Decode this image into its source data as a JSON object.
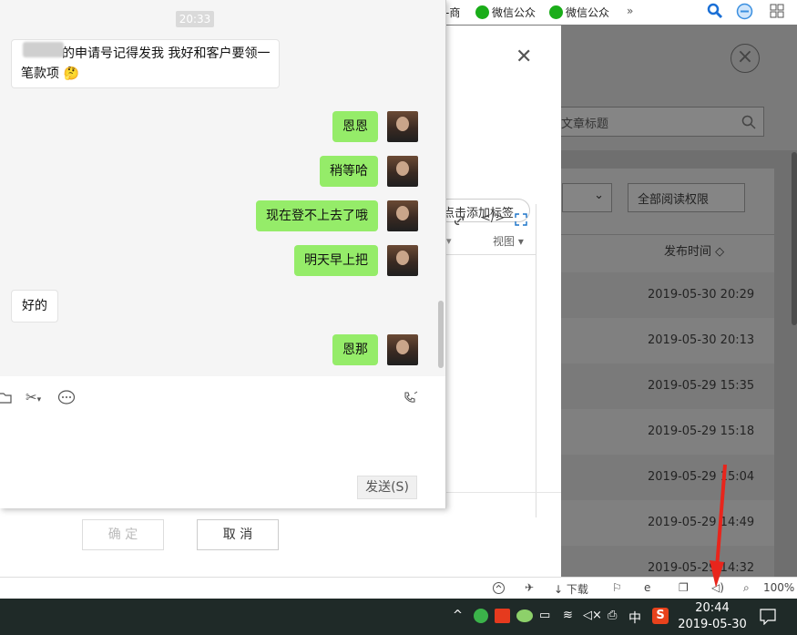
{
  "bookmarks": {
    "item1": "-商",
    "item2": "微信公众",
    "item3": "微信公众",
    "more": "»"
  },
  "background_page": {
    "search_placeholder": "文章标题",
    "filter_permission": "全部阅读权限",
    "column_publish_time": "发布时间 ◇",
    "dates": [
      "2019-05-30 20:29",
      "2019-05-30 20:13",
      "2019-05-29 15:35",
      "2019-05-29 15:18",
      "2019-05-29 15:04",
      "2019-05-29 14:49",
      "2019-05-29 14:32"
    ]
  },
  "editor_dialog": {
    "add_tag": "点击添加标签",
    "toolbar_view": "视图",
    "confirm": "确 定",
    "cancel": "取 消"
  },
  "chat": {
    "timestamp": "20:33",
    "messages": [
      {
        "side": "them",
        "text_line1": "的申请号记得发我 我好和客户要领一",
        "text_line2": "笔款项 🤔"
      },
      {
        "side": "me",
        "text": "恩恩"
      },
      {
        "side": "me",
        "text": "稍等哈"
      },
      {
        "side": "me",
        "text": "现在登不上去了哦"
      },
      {
        "side": "me",
        "text": "明天早上把"
      },
      {
        "side": "them",
        "text": "好的"
      },
      {
        "side": "me",
        "text": "恩那"
      }
    ],
    "send_label": "发送(S)"
  },
  "status_bar": {
    "download": "下载",
    "zoom": "100%"
  },
  "taskbar": {
    "time": "20:44",
    "date": "2019-05-30",
    "ime": "中"
  },
  "colors": {
    "my_bubble": "#95ec69",
    "arrow": "#e8251c",
    "taskbar": "#1f2a28"
  }
}
